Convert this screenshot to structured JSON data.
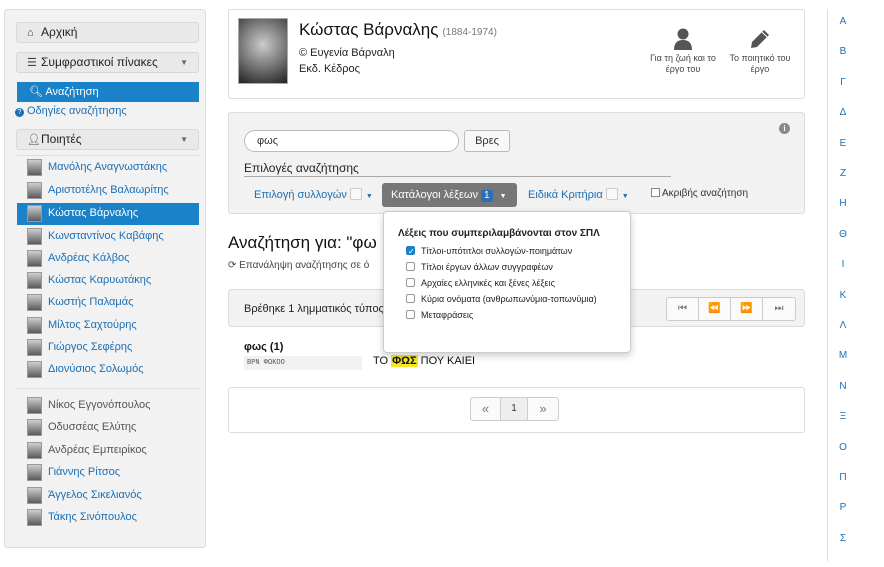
{
  "sidebar": {
    "home": "Αρχική",
    "concordances": "Συμφραστικοί πίνακες",
    "search": "Αναζήτηση",
    "search_help": "Οδηγίες αναζήτησης",
    "poets_header": "Ποιητές",
    "poets": [
      "Μανόλης Αναγνωστάκης",
      "Αριστοτέλης Βαλαωρίτης",
      "Κώστας Βάρναλης",
      "Κωνσταντίνος Καβάφης",
      "Ανδρέας Κάλβος",
      "Κώστας Καρυωτάκης",
      "Κωστής Παλαμάς",
      "Μίλτος Σαχτούρης",
      "Γιώργος Σεφέρης",
      "Διονύσιος Σολωμός"
    ],
    "poets_extra": [
      "Νίκος Εγγονόπουλος",
      "Οδυσσέας Ελύτης",
      "Ανδρέας Εμπειρίκος",
      "Γιάννης Ρίτσος",
      "Άγγελος Σικελιανός",
      "Τάκης Σινόπουλος"
    ]
  },
  "header": {
    "name": "Κώστας Βάρναλης",
    "years": "(1884-1974)",
    "copyright": "© Ευγενία Βάρναλη",
    "publisher": "Εκδ. Κέδρος",
    "life_label": "Για τη ζωή και το έργο του",
    "work_label": "Το ποιητικό του έργο"
  },
  "search": {
    "query": "φως",
    "button": "Βρες",
    "options_title": "Επιλογές αναζήτησης",
    "collections": "Επιλογή συλλογών",
    "catalogs": "Κατάλογοι λέξεων",
    "catalogs_count": "1",
    "criteria": "Ειδικά Κριτήρια",
    "exact": "Ακριβής αναζήτηση"
  },
  "dropdown": {
    "title": "Λέξεις που συμπεριλαμβάνονται στον ΣΠΛ",
    "items": [
      {
        "label": "Τίτλοι-υπότιτλοι συλλογών-ποιημάτων",
        "checked": true
      },
      {
        "label": "Τίτλοι έργων άλλων συγγραφέων",
        "checked": false
      },
      {
        "label": "Αρχαίες ελληνικές και ξένες λέξεις",
        "checked": false
      },
      {
        "label": "Κύρια ονόματα (ανθρωπωνύμια-τοπωνύμια)",
        "checked": false
      },
      {
        "label": "Μεταφράσεις",
        "checked": false
      }
    ]
  },
  "results": {
    "heading": "Αναζήτηση για: \"φω",
    "repeat": "Επανάληψη αναζήτησης σε ό",
    "found": "Βρέθηκε 1 λημματικός τύπος",
    "lemma": "φως (1)",
    "code": "ΒΡΝ ΦΩΚΟΟ",
    "text_before": "ΤΟ ",
    "text_highlight": "ΦΩΣ",
    "text_after": " ΠΟΥ ΚΑΙΕΙ",
    "pager_first": "⏮",
    "pager_prev": "⏪",
    "pager_next": "⏩",
    "pager_last": "⏭",
    "bottom_prev": "«",
    "bottom_page": "1",
    "bottom_next": "»"
  },
  "alphabet": [
    "Α",
    "Β",
    "Γ",
    "Δ",
    "Ε",
    "Ζ",
    "Η",
    "Θ",
    "Ι",
    "Κ",
    "Λ",
    "Μ",
    "Ν",
    "Ξ",
    "Ο",
    "Π",
    "Ρ",
    "Σ"
  ],
  "colors": {
    "accent": "#1a82c9",
    "link": "#1a6fb5",
    "highlight": "#f5e726"
  }
}
